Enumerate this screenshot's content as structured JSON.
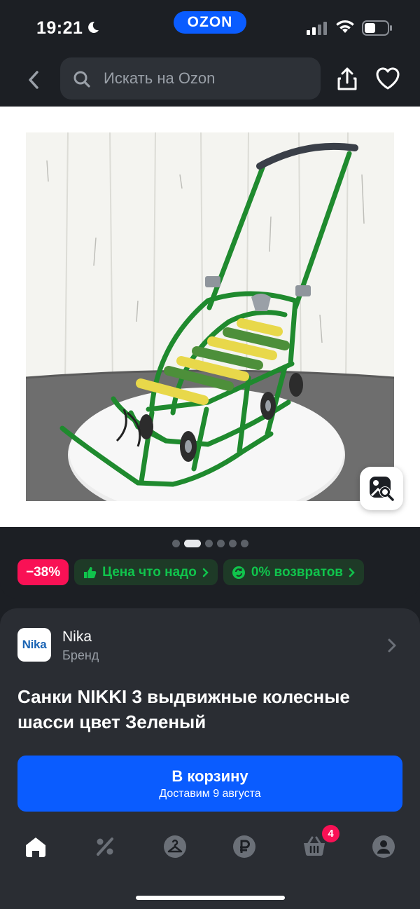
{
  "status_bar": {
    "time": "19:21",
    "brand": "OZON",
    "icons": [
      "moon-icon",
      "cellular-signal-icon",
      "wifi-icon",
      "battery-icon"
    ]
  },
  "top_bar": {
    "search_placeholder": "Искать на Ozon",
    "icons": [
      "back-arrow-icon",
      "search-icon",
      "share-icon",
      "heart-icon"
    ]
  },
  "gallery": {
    "image_count": 6,
    "active_index": 1,
    "lens_icon": "image-search-icon"
  },
  "badges": {
    "discount": "−38%",
    "price_promo": "Цена что надо",
    "returns": "0% возвратов"
  },
  "product": {
    "brand_name": "Nika",
    "brand_logo_text": "Nika",
    "brand_label": "Бренд",
    "title": "Санки NIKKI 3 выдвижные колесные шасси цвет Зеленый"
  },
  "cart_button": {
    "label": "В корзину",
    "delivery": "Доставим 9 августа"
  },
  "bottom_nav": {
    "items": [
      "home-icon",
      "discount-icon",
      "hanger-icon",
      "ruble-icon",
      "cart-icon",
      "profile-icon"
    ],
    "cart_count": "4"
  },
  "colors": {
    "accent_blue": "#0a5cff",
    "discount_pink": "#f91155",
    "promo_green": "#10c44c",
    "background": "#1c1f24",
    "card": "#2a2d33"
  }
}
